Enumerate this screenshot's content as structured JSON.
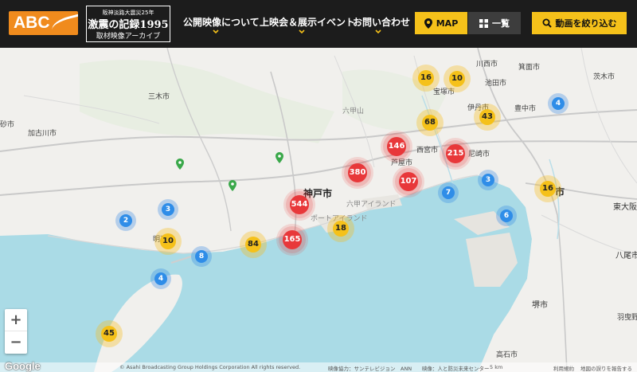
{
  "header": {
    "logo_text": "ABC",
    "archive": {
      "line1": "阪神淡路大震災25年",
      "line2": "激震の記録1995",
      "line3": "取材映像アーカイブ"
    },
    "nav": [
      {
        "label": "公開映像について"
      },
      {
        "label": "上映会＆展示イベント"
      },
      {
        "label": "お問い合わせ"
      }
    ],
    "map_button": "MAP",
    "list_button": "一覧",
    "filter_button": "動画を絞り込む"
  },
  "map": {
    "places": {
      "kawanishi": "川西市",
      "minoo": "箕面市",
      "ibaraki": "茨木市",
      "takarazuka": "宝塚市",
      "ikeda": "池田市",
      "itami": "伊丹市",
      "toyonaka": "豊中市",
      "miki": "三木市",
      "rokkosan": "六甲山",
      "kakogawa": "加古川市",
      "takasago": "砂市",
      "nishinomiya": "西宮市",
      "amagasaki": "尼崎市",
      "ashiya": "芦屋市",
      "kobe": "神戸市",
      "osaka": "市",
      "higashiosaka": "東大阪",
      "akashi": "明石",
      "yao": "八尾市",
      "sakai": "堺市",
      "habikino": "羽曳野",
      "takaishi": "高石市",
      "rokko_island": "六甲アイランド",
      "port_island": "ポートアイランド"
    },
    "clusters": [
      {
        "count": "16",
        "color": "yellow"
      },
      {
        "count": "10",
        "color": "yellow"
      },
      {
        "count": "4",
        "color": "blue"
      },
      {
        "count": "68",
        "color": "yellow"
      },
      {
        "count": "43",
        "color": "yellow"
      },
      {
        "count": "146",
        "color": "red"
      },
      {
        "count": "215",
        "color": "red"
      },
      {
        "count": "380",
        "color": "red"
      },
      {
        "count": "107",
        "color": "red"
      },
      {
        "count": "3",
        "color": "blue"
      },
      {
        "count": "7",
        "color": "blue"
      },
      {
        "count": "16",
        "color": "yellow"
      },
      {
        "count": "544",
        "color": "red"
      },
      {
        "count": "18",
        "color": "yellow"
      },
      {
        "count": "6",
        "color": "blue"
      },
      {
        "count": "3",
        "color": "blue"
      },
      {
        "count": "2",
        "color": "blue"
      },
      {
        "count": "10",
        "color": "yellow"
      },
      {
        "count": "84",
        "color": "yellow"
      },
      {
        "count": "165",
        "color": "red"
      },
      {
        "count": "8",
        "color": "blue"
      },
      {
        "count": "4",
        "color": "blue"
      },
      {
        "count": "45",
        "color": "yellow"
      }
    ],
    "zoom_in": "+",
    "zoom_out": "−",
    "google": "Google",
    "attribution": {
      "copyright": "© Asahi Broadcasting Group Holdings Corporation All rights reserved.",
      "coop": "映像協力：サンテレビジョン　ANN",
      "other": "映像：人と防災未来センター",
      "scale": "5 km",
      "terms": "利用規約",
      "report": "地図の誤りを報告する"
    }
  },
  "colors": {
    "header_bg": "#1c1c1c",
    "accent_yellow": "#f5c11a",
    "abc_orange": "#f08b1d",
    "cluster_red": "#e8383a",
    "cluster_blue": "#2f8de8",
    "sea": "#aadbe6",
    "land": "#f1f0ed"
  }
}
